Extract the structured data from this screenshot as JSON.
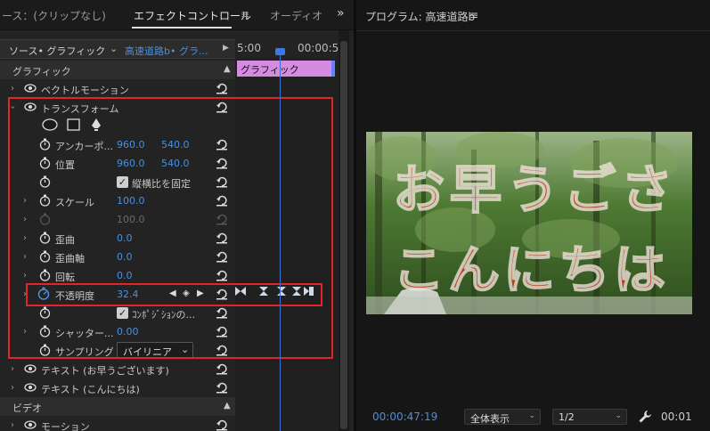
{
  "tabs": {
    "source": "ース：(クリップなし)",
    "effect_controls": "エフェクトコントロール",
    "audio": "オーディオ",
    "menu_icon": "≡",
    "more": "»"
  },
  "source_row": {
    "source_label": "ソース• グラフィック",
    "clip_label": "高速道路b• グラ...",
    "time_start": "5:00",
    "time_end": "00:00:5"
  },
  "timeline": {
    "clip_name": "グラフィック"
  },
  "sections": {
    "graphic": "グラフィック",
    "video": "ビデオ"
  },
  "rows": {
    "vector_motion": "ベクトルモーション",
    "transform": "トランスフォーム",
    "anchor": {
      "label": "アンカーポ...",
      "x": "960.0",
      "y": "540.0"
    },
    "position": {
      "label": "位置",
      "x": "960.0",
      "y": "540.0"
    },
    "uniform_scale": "縦横比を固定",
    "scale": {
      "label": "スケール",
      "value": "100.0"
    },
    "scale_width": {
      "value": "100.0"
    },
    "skew": {
      "label": "歪曲",
      "value": "0.0"
    },
    "skew_axis": {
      "label": "歪曲軸",
      "value": "0.0"
    },
    "rotation": {
      "label": "回転",
      "value": "0.0"
    },
    "opacity": {
      "label": "不透明度",
      "value": "32.4"
    },
    "comp_shutter": "ｺﾝﾎﾟｼﾞｼｮﾝの...",
    "shutter_angle": {
      "label": "シャッター...",
      "value": "0.00"
    },
    "sampling": {
      "label": "サンプリング",
      "value": "バイリニア"
    },
    "text1": "テキスト (お早うございます)",
    "text2": "テキスト (こんにちは)",
    "motion": "モーション"
  },
  "program": {
    "title": "プログラム: 高速道路b",
    "menu_icon": "≡",
    "timecode": "00:00:47:19",
    "fit_label": "全体表示",
    "resolution": "1/2",
    "duration": "00:01"
  },
  "video_text": {
    "line1": "お早うごさ",
    "line2": "こんにちは"
  },
  "colors": {
    "accent_blue": "#4a8fe0",
    "clip_pink": "#d58be1",
    "highlight_red": "#e0262a",
    "caption_red": "#d9361c"
  }
}
